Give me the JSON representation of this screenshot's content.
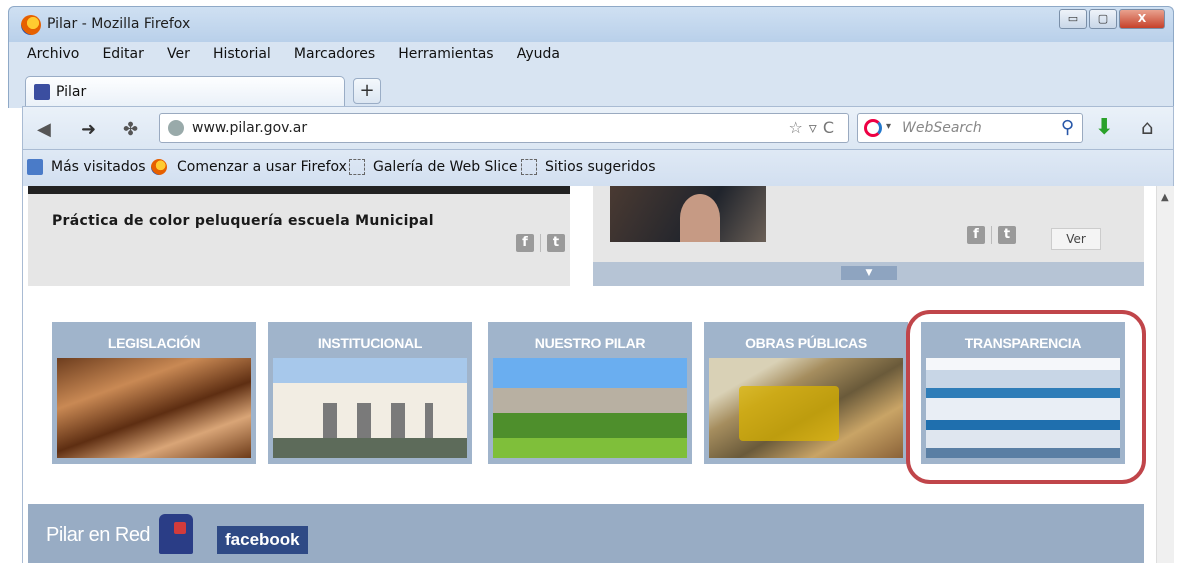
{
  "window": {
    "title": "Pilar - Mozilla Firefox",
    "buttons": {
      "minimize": "▭",
      "maximize": "▢",
      "close": "X"
    }
  },
  "menu": [
    "Archivo",
    "Editar",
    "Ver",
    "Historial",
    "Marcadores",
    "Herramientas",
    "Ayuda"
  ],
  "tabs": {
    "active_label": "Pilar",
    "new_tab": "+"
  },
  "navbar": {
    "url": "www.pilar.gov.ar",
    "search_placeholder": "WebSearch",
    "back_icon": "back-arrow-icon",
    "forward_icon": "forward-arrow-icon"
  },
  "bookmarks": [
    "Más visitados",
    "Comenzar a usar Firefox",
    "Galería de Web Slice",
    "Sitios sugeridos"
  ],
  "page": {
    "news_left": {
      "headline": "Práctica de color peluquería escuela Municipal"
    },
    "news_right": {
      "button": "Ver"
    },
    "categories": [
      "LEGISLACIÓN",
      "INSTITUCIONAL",
      "NUESTRO PILAR",
      "OBRAS PÚBLICAS",
      "TRANSPARENCIA"
    ],
    "pilar_en_red": {
      "title": "Pilar en Red",
      "facebook": "facebook"
    }
  },
  "colors": {
    "highlight": "#c0454a",
    "tile_header": "#a0b4cb",
    "footer_bar": "#98acc4"
  }
}
